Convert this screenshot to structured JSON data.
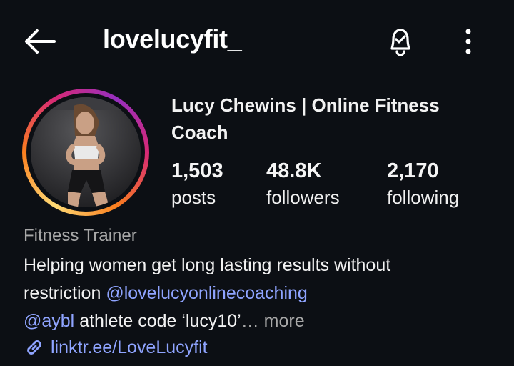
{
  "header": {
    "username": "lovelucyfit_",
    "back_icon": "arrow-left-icon",
    "bell_icon": "bell-check-icon",
    "more_icon": "kebab-menu-icon"
  },
  "profile": {
    "display_name": "Lucy Chewins | Online Fitness Coach",
    "ring_colors": [
      "#feda75",
      "#fa7e1e",
      "#d62976",
      "#962fbf"
    ]
  },
  "stats": [
    {
      "value": "1,503",
      "label": "posts"
    },
    {
      "value": "48.8K",
      "label": "followers"
    },
    {
      "value": "2,170",
      "label": "following"
    }
  ],
  "bio": {
    "category": "Fitness Trainer",
    "line1": "Helping women get long lasting results without",
    "line2_text": "restriction ",
    "line2_mention": "@lovelucyonlinecoaching",
    "line3_mention": "@aybl",
    "line3_text": " athlete code ‘lucy10’",
    "ellipsis": "…",
    "more_label": " more",
    "link_icon": "link-icon",
    "link_text": "linktr.ee/LoveLucyfit",
    "link_color": "#8fa4ff"
  }
}
